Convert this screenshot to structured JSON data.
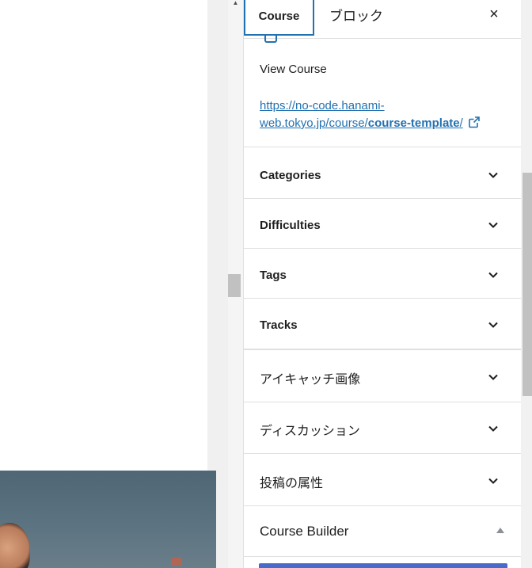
{
  "tabs": {
    "active_label": "Course",
    "inactive_label": "ブロック"
  },
  "close_icon": "×",
  "summary": {
    "view_label": "View Course",
    "link_prefix": "https://no-code.hanami-web.tokyo.jp/course/",
    "link_slug": "course-template",
    "link_suffix": "/"
  },
  "panels": [
    {
      "title": "Categories"
    },
    {
      "title": "Difficulties"
    },
    {
      "title": "Tags"
    },
    {
      "title": "Tracks"
    },
    {
      "title": "アイキャッチ画像"
    },
    {
      "title": "ディスカッション"
    },
    {
      "title": "投稿の属性"
    },
    {
      "title": "Course Builder"
    }
  ],
  "icons": {
    "external_link": "external-link-icon",
    "chevron": "chevron-down-icon",
    "caret_up": "caret-up-icon"
  },
  "colors": {
    "accent": "#2271b1",
    "builder_button": "#4a6ac9"
  }
}
